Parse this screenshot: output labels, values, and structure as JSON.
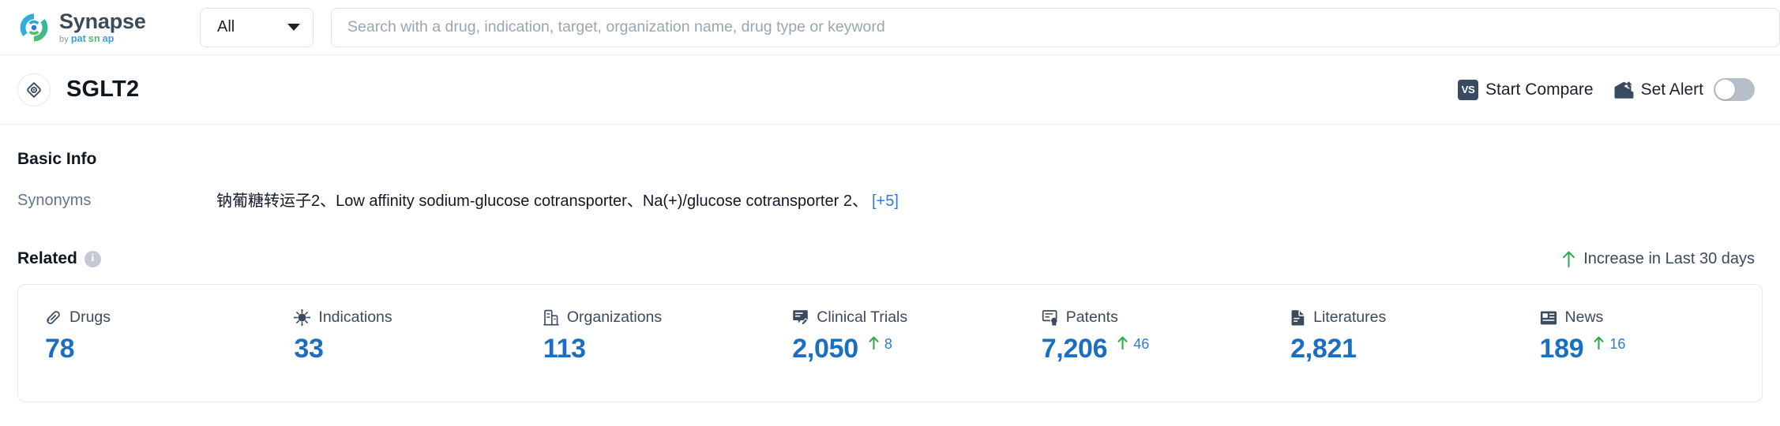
{
  "topbar": {
    "brand": {
      "name": "Synapse",
      "by": "by",
      "sub_pat": "pat",
      "sub_sn": "sn",
      "sub_ap": "ap"
    },
    "scope": {
      "label": "All",
      "icon": "chevron-down-icon"
    },
    "search": {
      "value": "",
      "placeholder": "Search with a drug, indication, target, organization name, drug type or keyword"
    }
  },
  "entity": {
    "icon": "target-icon",
    "title": "SGLT2",
    "actions": {
      "compare": {
        "label": "Start Compare",
        "badge": "VS"
      },
      "alert": {
        "label": "Set Alert",
        "icon": "alert-mail-icon",
        "toggle_on": false
      }
    }
  },
  "basic_info": {
    "title": "Basic Info",
    "synonyms_key": "Synonyms",
    "synonyms_value": "钠葡糖转运子2、Low affinity sodium-glucose cotransporter、Na(+)/glucose cotransporter 2、",
    "synonyms_more": "[+5]"
  },
  "related": {
    "label": "Related",
    "info_icon": "info-icon",
    "legend": {
      "arrow_icon": "arrow-up-icon",
      "text": "Increase in Last 30 days",
      "color": "#2eab4d"
    },
    "colors": {
      "number": "#1a6fc4",
      "delta": "#2f7bd6",
      "arrow": "#2eab4d"
    },
    "stats": [
      {
        "icon": "pill-icon",
        "name": "Drugs",
        "value": "78",
        "delta": null
      },
      {
        "icon": "virus-icon",
        "name": "Indications",
        "value": "33",
        "delta": null
      },
      {
        "icon": "building-icon",
        "name": "Organizations",
        "value": "113",
        "delta": null
      },
      {
        "icon": "clinical-trial-icon",
        "name": "Clinical Trials",
        "value": "2,050",
        "delta": "8"
      },
      {
        "icon": "patent-icon",
        "name": "Patents",
        "value": "7,206",
        "delta": "46"
      },
      {
        "icon": "literature-icon",
        "name": "Literatures",
        "value": "2,821",
        "delta": null
      },
      {
        "icon": "news-icon",
        "name": "News",
        "value": "189",
        "delta": "16"
      }
    ]
  }
}
